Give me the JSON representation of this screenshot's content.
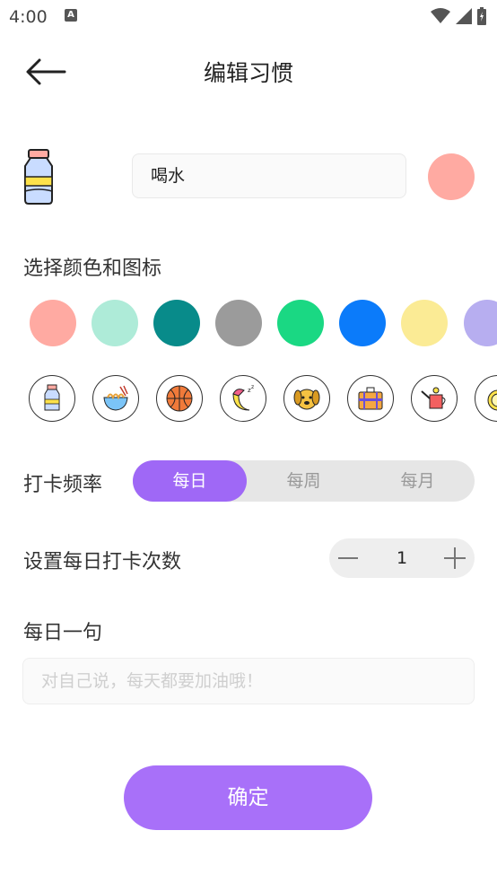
{
  "status_bar": {
    "time": "4:00",
    "notif_letter": "A"
  },
  "header": {
    "title": "编辑习惯"
  },
  "habit": {
    "name": "喝水",
    "selected_color": "#ffaaa2",
    "icon": "water-bottle-icon"
  },
  "sections": {
    "color_icon_label": "选择颜色和图标",
    "frequency_label": "打卡频率",
    "times_label": "设置每日打卡次数",
    "motto_label": "每日一句"
  },
  "colors": [
    "#ffaaa2",
    "#aeebd8",
    "#088b8a",
    "#9b9b9b",
    "#1ad883",
    "#0b7bfa",
    "#fbeb95",
    "#b7aef0"
  ],
  "icons": [
    "water-bottle-icon",
    "noodle-bowl-icon",
    "basketball-icon",
    "sleeping-moon-icon",
    "dog-icon",
    "briefcase-icon",
    "watering-can-icon",
    "lemon-icon"
  ],
  "frequency": {
    "options": [
      "每日",
      "每周",
      "每月"
    ],
    "selected": "每日"
  },
  "times": {
    "value": "1",
    "minus": "minus-icon",
    "plus": "plus-icon"
  },
  "motto": {
    "placeholder": "对自己说，每天都要加油哦！"
  },
  "confirm_label": "确定",
  "accent": "#9f68f6"
}
